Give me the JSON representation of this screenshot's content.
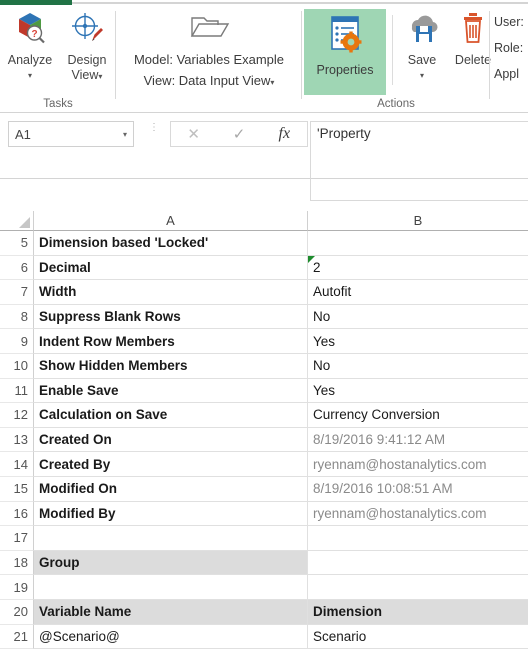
{
  "app": {
    "tab_active": "active-ribbon-tab"
  },
  "ribbon": {
    "groups": [
      {
        "label": "Tasks"
      },
      {
        "label": ""
      },
      {
        "label": "Actions"
      },
      {
        "label": ""
      }
    ],
    "tasks": {
      "group_label": "Tasks",
      "analyze": {
        "label_line1": "Analyze",
        "caret": "▾",
        "icon": "cube-magnifier-question-icon"
      },
      "design_view": {
        "label_line1": "Design",
        "label_line2": "View",
        "caret": "▾",
        "icon": "crosshair-pencil-icon"
      }
    },
    "model": {
      "line1": "Model: Variables Example",
      "line2": "View: Data Input View",
      "caret": "▾",
      "icon": "open-folder-icon"
    },
    "actions": {
      "group_label": "Actions",
      "properties": {
        "label": "Properties",
        "icon": "document-gear-icon",
        "selected": true,
        "highlight_color": "#9FD6B4"
      },
      "save": {
        "label": "Save",
        "caret": "▾",
        "icon": "cloud-save-icon"
      },
      "delete": {
        "label": "Delete",
        "icon": "trash-can-icon"
      }
    },
    "user_panel": {
      "line1": "User:",
      "line2": "Role:",
      "line3": "Appl"
    }
  },
  "formula_bar": {
    "name_box_value": "A1",
    "name_box_caret": "▾",
    "cancel_icon": "✕",
    "enter_icon": "✓",
    "function_icon": "fx",
    "formula_value": "'Property"
  },
  "grid": {
    "columns": [
      {
        "id": "A",
        "label": "A"
      },
      {
        "id": "B",
        "label": "B"
      }
    ],
    "rows": [
      {
        "num": "5",
        "a": "Dimension based 'Locked'",
        "b": "",
        "a_bold": true,
        "b_muted": false,
        "a_shade": false,
        "b_shade": false,
        "b_error": false
      },
      {
        "num": "6",
        "a": "Decimal",
        "b": "2",
        "a_bold": true,
        "b_muted": false,
        "a_shade": false,
        "b_shade": false,
        "b_error": true
      },
      {
        "num": "7",
        "a": "Width",
        "b": "Autofit",
        "a_bold": true,
        "b_muted": false,
        "a_shade": false,
        "b_shade": false,
        "b_error": false
      },
      {
        "num": "8",
        "a": "Suppress Blank Rows",
        "b": "No",
        "a_bold": true,
        "b_muted": false,
        "a_shade": false,
        "b_shade": false,
        "b_error": false
      },
      {
        "num": "9",
        "a": "Indent Row Members",
        "b": "Yes",
        "a_bold": true,
        "b_muted": false,
        "a_shade": false,
        "b_shade": false,
        "b_error": false
      },
      {
        "num": "10",
        "a": "Show Hidden Members",
        "b": "No",
        "a_bold": true,
        "b_muted": false,
        "a_shade": false,
        "b_shade": false,
        "b_error": false
      },
      {
        "num": "11",
        "a": "Enable Save",
        "b": "Yes",
        "a_bold": true,
        "b_muted": false,
        "a_shade": false,
        "b_shade": false,
        "b_error": false
      },
      {
        "num": "12",
        "a": "Calculation on Save",
        "b": "Currency Conversion",
        "a_bold": true,
        "b_muted": false,
        "a_shade": false,
        "b_shade": false,
        "b_error": false
      },
      {
        "num": "13",
        "a": "Created On",
        "b": "8/19/2016 9:41:12 AM",
        "a_bold": true,
        "b_muted": true,
        "a_shade": false,
        "b_shade": false,
        "b_error": false
      },
      {
        "num": "14",
        "a": "Created By",
        "b": "ryennam@hostanalytics.com",
        "a_bold": true,
        "b_muted": true,
        "a_shade": false,
        "b_shade": false,
        "b_error": false
      },
      {
        "num": "15",
        "a": "Modified On",
        "b": "8/19/2016 10:08:51 AM",
        "a_bold": true,
        "b_muted": true,
        "a_shade": false,
        "b_shade": false,
        "b_error": false
      },
      {
        "num": "16",
        "a": "Modified By",
        "b": "ryennam@hostanalytics.com",
        "a_bold": true,
        "b_muted": true,
        "a_shade": false,
        "b_shade": false,
        "b_error": false
      },
      {
        "num": "17",
        "a": "",
        "b": "",
        "a_bold": false,
        "b_muted": false,
        "a_shade": false,
        "b_shade": false,
        "b_error": false
      },
      {
        "num": "18",
        "a": "Group",
        "b": "",
        "a_bold": true,
        "b_muted": false,
        "a_shade": true,
        "b_shade": false,
        "b_error": false
      },
      {
        "num": "19",
        "a": "",
        "b": "",
        "a_bold": false,
        "b_muted": false,
        "a_shade": false,
        "b_shade": false,
        "b_error": false
      },
      {
        "num": "20",
        "a": "Variable Name",
        "b": "Dimension",
        "a_bold": true,
        "b_muted": false,
        "a_shade": true,
        "b_shade": true,
        "b_error": false
      },
      {
        "num": "21",
        "a": "@Scenario@",
        "b": "Scenario",
        "a_bold": false,
        "b_muted": false,
        "a_shade": false,
        "b_shade": false,
        "b_error": false
      }
    ]
  },
  "colors": {
    "excel_green": "#217346",
    "selection_green": "#9FD6B4",
    "shade_gray": "#dcdcdc",
    "muted_text": "#8a8a8a",
    "error_marker_green": "#1f8c2e"
  }
}
